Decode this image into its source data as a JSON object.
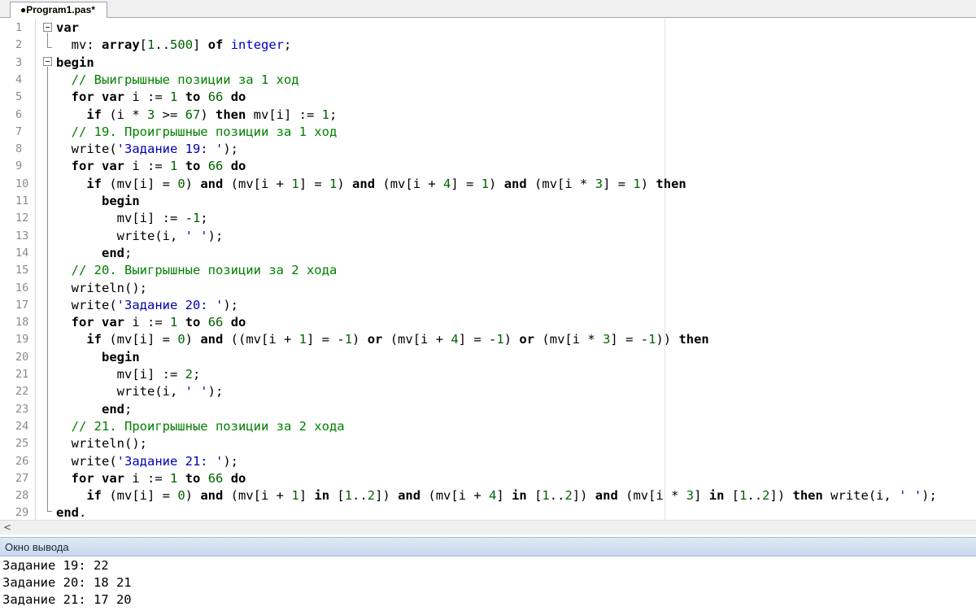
{
  "tab": {
    "title": "●Program1.pas*"
  },
  "editor": {
    "line_numbers": [
      "1",
      "2",
      "3",
      "4",
      "5",
      "6",
      "7",
      "8",
      "9",
      "10",
      "11",
      "12",
      "13",
      "14",
      "15",
      "16",
      "17",
      "18",
      "19",
      "20",
      "21",
      "22",
      "23",
      "24",
      "25",
      "26",
      "27",
      "28",
      "29"
    ],
    "lines": [
      [
        {
          "t": "kw",
          "v": "var"
        }
      ],
      [
        {
          "t": "p",
          "v": "  mv: "
        },
        {
          "t": "kw",
          "v": "array"
        },
        {
          "t": "p",
          "v": "["
        },
        {
          "t": "num",
          "v": "1"
        },
        {
          "t": "p",
          "v": ".."
        },
        {
          "t": "num",
          "v": "500"
        },
        {
          "t": "p",
          "v": "] "
        },
        {
          "t": "kw",
          "v": "of"
        },
        {
          "t": "p",
          "v": " "
        },
        {
          "t": "ty",
          "v": "integer"
        },
        {
          "t": "p",
          "v": ";"
        }
      ],
      [
        {
          "t": "kw",
          "v": "begin"
        }
      ],
      [
        {
          "t": "cm",
          "v": "  // Выигрышные позиции за 1 ход"
        }
      ],
      [
        {
          "t": "p",
          "v": "  "
        },
        {
          "t": "kw",
          "v": "for var"
        },
        {
          "t": "p",
          "v": " i := "
        },
        {
          "t": "num",
          "v": "1"
        },
        {
          "t": "p",
          "v": " "
        },
        {
          "t": "kw",
          "v": "to"
        },
        {
          "t": "p",
          "v": " "
        },
        {
          "t": "num",
          "v": "66"
        },
        {
          "t": "p",
          "v": " "
        },
        {
          "t": "kw",
          "v": "do"
        }
      ],
      [
        {
          "t": "p",
          "v": "    "
        },
        {
          "t": "kw",
          "v": "if"
        },
        {
          "t": "p",
          "v": " (i * "
        },
        {
          "t": "num",
          "v": "3"
        },
        {
          "t": "p",
          "v": " >= "
        },
        {
          "t": "num",
          "v": "67"
        },
        {
          "t": "p",
          "v": ") "
        },
        {
          "t": "kw",
          "v": "then"
        },
        {
          "t": "p",
          "v": " mv[i] := "
        },
        {
          "t": "num",
          "v": "1"
        },
        {
          "t": "p",
          "v": ";"
        }
      ],
      [
        {
          "t": "cm",
          "v": "  // 19. Проигрышные позиции за 1 ход"
        }
      ],
      [
        {
          "t": "p",
          "v": "  write("
        },
        {
          "t": "str",
          "v": "'Задание 19: '"
        },
        {
          "t": "p",
          "v": ");"
        }
      ],
      [
        {
          "t": "p",
          "v": "  "
        },
        {
          "t": "kw",
          "v": "for var"
        },
        {
          "t": "p",
          "v": " i := "
        },
        {
          "t": "num",
          "v": "1"
        },
        {
          "t": "p",
          "v": " "
        },
        {
          "t": "kw",
          "v": "to"
        },
        {
          "t": "p",
          "v": " "
        },
        {
          "t": "num",
          "v": "66"
        },
        {
          "t": "p",
          "v": " "
        },
        {
          "t": "kw",
          "v": "do"
        }
      ],
      [
        {
          "t": "p",
          "v": "    "
        },
        {
          "t": "kw",
          "v": "if"
        },
        {
          "t": "p",
          "v": " (mv[i] = "
        },
        {
          "t": "num",
          "v": "0"
        },
        {
          "t": "p",
          "v": ") "
        },
        {
          "t": "kw",
          "v": "and"
        },
        {
          "t": "p",
          "v": " (mv[i + "
        },
        {
          "t": "num",
          "v": "1"
        },
        {
          "t": "p",
          "v": "] = "
        },
        {
          "t": "num",
          "v": "1"
        },
        {
          "t": "p",
          "v": ") "
        },
        {
          "t": "kw",
          "v": "and"
        },
        {
          "t": "p",
          "v": " (mv[i + "
        },
        {
          "t": "num",
          "v": "4"
        },
        {
          "t": "p",
          "v": "] = "
        },
        {
          "t": "num",
          "v": "1"
        },
        {
          "t": "p",
          "v": ") "
        },
        {
          "t": "kw",
          "v": "and"
        },
        {
          "t": "p",
          "v": " (mv[i * "
        },
        {
          "t": "num",
          "v": "3"
        },
        {
          "t": "p",
          "v": "] = "
        },
        {
          "t": "num",
          "v": "1"
        },
        {
          "t": "p",
          "v": ") "
        },
        {
          "t": "kw",
          "v": "then"
        }
      ],
      [
        {
          "t": "p",
          "v": "      "
        },
        {
          "t": "kw",
          "v": "begin"
        }
      ],
      [
        {
          "t": "p",
          "v": "        mv[i] := -"
        },
        {
          "t": "num",
          "v": "1"
        },
        {
          "t": "p",
          "v": ";"
        }
      ],
      [
        {
          "t": "p",
          "v": "        write(i, "
        },
        {
          "t": "str",
          "v": "' '"
        },
        {
          "t": "p",
          "v": ");"
        }
      ],
      [
        {
          "t": "p",
          "v": "      "
        },
        {
          "t": "kw",
          "v": "end"
        },
        {
          "t": "p",
          "v": ";"
        }
      ],
      [
        {
          "t": "cm",
          "v": "  // 20. Выигрышные позиции за 2 хода"
        }
      ],
      [
        {
          "t": "p",
          "v": "  writeln();"
        }
      ],
      [
        {
          "t": "p",
          "v": "  write("
        },
        {
          "t": "str",
          "v": "'Задание 20: '"
        },
        {
          "t": "p",
          "v": ");"
        }
      ],
      [
        {
          "t": "p",
          "v": "  "
        },
        {
          "t": "kw",
          "v": "for var"
        },
        {
          "t": "p",
          "v": " i := "
        },
        {
          "t": "num",
          "v": "1"
        },
        {
          "t": "p",
          "v": " "
        },
        {
          "t": "kw",
          "v": "to"
        },
        {
          "t": "p",
          "v": " "
        },
        {
          "t": "num",
          "v": "66"
        },
        {
          "t": "p",
          "v": " "
        },
        {
          "t": "kw",
          "v": "do"
        }
      ],
      [
        {
          "t": "p",
          "v": "    "
        },
        {
          "t": "kw",
          "v": "if"
        },
        {
          "t": "p",
          "v": " (mv[i] = "
        },
        {
          "t": "num",
          "v": "0"
        },
        {
          "t": "p",
          "v": ") "
        },
        {
          "t": "kw",
          "v": "and"
        },
        {
          "t": "p",
          "v": " ((mv[i + "
        },
        {
          "t": "num",
          "v": "1"
        },
        {
          "t": "p",
          "v": "] = -"
        },
        {
          "t": "num",
          "v": "1"
        },
        {
          "t": "p",
          "v": ") "
        },
        {
          "t": "kw",
          "v": "or"
        },
        {
          "t": "p",
          "v": " (mv[i + "
        },
        {
          "t": "num",
          "v": "4"
        },
        {
          "t": "p",
          "v": "] = -"
        },
        {
          "t": "num",
          "v": "1"
        },
        {
          "t": "p",
          "v": ") "
        },
        {
          "t": "kw",
          "v": "or"
        },
        {
          "t": "p",
          "v": " (mv[i * "
        },
        {
          "t": "num",
          "v": "3"
        },
        {
          "t": "p",
          "v": "] = -"
        },
        {
          "t": "num",
          "v": "1"
        },
        {
          "t": "p",
          "v": ")) "
        },
        {
          "t": "kw",
          "v": "then"
        }
      ],
      [
        {
          "t": "p",
          "v": "      "
        },
        {
          "t": "kw",
          "v": "begin"
        }
      ],
      [
        {
          "t": "p",
          "v": "        mv[i] := "
        },
        {
          "t": "num",
          "v": "2"
        },
        {
          "t": "p",
          "v": ";"
        }
      ],
      [
        {
          "t": "p",
          "v": "        write(i, "
        },
        {
          "t": "str",
          "v": "' '"
        },
        {
          "t": "p",
          "v": ");"
        }
      ],
      [
        {
          "t": "p",
          "v": "      "
        },
        {
          "t": "kw",
          "v": "end"
        },
        {
          "t": "p",
          "v": ";"
        }
      ],
      [
        {
          "t": "cm",
          "v": "  // 21. Проигрышные позиции за 2 хода"
        }
      ],
      [
        {
          "t": "p",
          "v": "  writeln();"
        }
      ],
      [
        {
          "t": "p",
          "v": "  write("
        },
        {
          "t": "str",
          "v": "'Задание 21: '"
        },
        {
          "t": "p",
          "v": ");"
        }
      ],
      [
        {
          "t": "p",
          "v": "  "
        },
        {
          "t": "kw",
          "v": "for var"
        },
        {
          "t": "p",
          "v": " i := "
        },
        {
          "t": "num",
          "v": "1"
        },
        {
          "t": "p",
          "v": " "
        },
        {
          "t": "kw",
          "v": "to"
        },
        {
          "t": "p",
          "v": " "
        },
        {
          "t": "num",
          "v": "66"
        },
        {
          "t": "p",
          "v": " "
        },
        {
          "t": "kw",
          "v": "do"
        }
      ],
      [
        {
          "t": "p",
          "v": "    "
        },
        {
          "t": "kw",
          "v": "if"
        },
        {
          "t": "p",
          "v": " (mv[i] = "
        },
        {
          "t": "num",
          "v": "0"
        },
        {
          "t": "p",
          "v": ") "
        },
        {
          "t": "kw",
          "v": "and"
        },
        {
          "t": "p",
          "v": " (mv[i + "
        },
        {
          "t": "num",
          "v": "1"
        },
        {
          "t": "p",
          "v": "] "
        },
        {
          "t": "kw",
          "v": "in"
        },
        {
          "t": "p",
          "v": " ["
        },
        {
          "t": "num",
          "v": "1"
        },
        {
          "t": "p",
          "v": ".."
        },
        {
          "t": "num",
          "v": "2"
        },
        {
          "t": "p",
          "v": "]) "
        },
        {
          "t": "kw",
          "v": "and"
        },
        {
          "t": "p",
          "v": " (mv[i + "
        },
        {
          "t": "num",
          "v": "4"
        },
        {
          "t": "p",
          "v": "] "
        },
        {
          "t": "kw",
          "v": "in"
        },
        {
          "t": "p",
          "v": " ["
        },
        {
          "t": "num",
          "v": "1"
        },
        {
          "t": "p",
          "v": ".."
        },
        {
          "t": "num",
          "v": "2"
        },
        {
          "t": "p",
          "v": "]) "
        },
        {
          "t": "kw",
          "v": "and"
        },
        {
          "t": "p",
          "v": " (mv[i * "
        },
        {
          "t": "num",
          "v": "3"
        },
        {
          "t": "p",
          "v": "] "
        },
        {
          "t": "kw",
          "v": "in"
        },
        {
          "t": "p",
          "v": " ["
        },
        {
          "t": "num",
          "v": "1"
        },
        {
          "t": "p",
          "v": ".."
        },
        {
          "t": "num",
          "v": "2"
        },
        {
          "t": "p",
          "v": "]) "
        },
        {
          "t": "kw",
          "v": "then"
        },
        {
          "t": "p",
          "v": " write(i, "
        },
        {
          "t": "str",
          "v": "' '"
        },
        {
          "t": "p",
          "v": ");"
        }
      ],
      [
        {
          "t": "kw",
          "v": "end"
        },
        {
          "t": "p",
          "v": "."
        }
      ]
    ]
  },
  "scrollbar": {
    "left_arrow": "<"
  },
  "output": {
    "title": "Окно вывода",
    "lines": [
      "Задание 19: 22",
      "Задание 20: 18 21",
      "Задание 21: 17 20"
    ]
  },
  "colors": {
    "keyword": "#000000",
    "type": "#0000c8",
    "number": "#006400",
    "string": "#0000b0",
    "comment": "#008000",
    "output_header": "#c9d9ee"
  }
}
